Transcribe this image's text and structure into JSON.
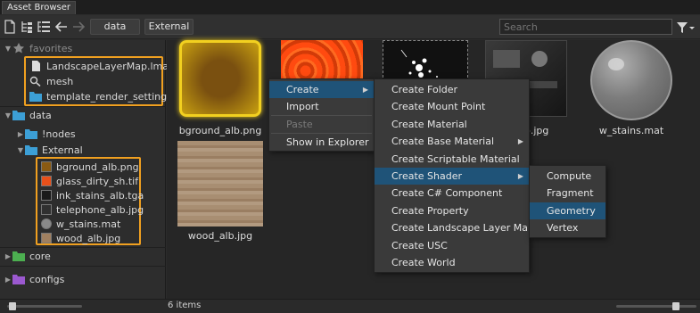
{
  "window": {
    "tab_title": "Asset Browser"
  },
  "toolbar": {
    "path": [
      "data",
      "External"
    ],
    "search_placeholder": "Search",
    "icons": [
      "new-file-icon",
      "tree-view-icon",
      "list-view-icon",
      "back-arrow-icon",
      "forward-arrow-icon",
      "filter-icon"
    ]
  },
  "sidebar": {
    "favorites_label": "favorites",
    "favorites": [
      {
        "label": "LandscapeLayerMap.lmap",
        "icon": "file-icon"
      },
      {
        "label": "mesh",
        "icon": "search-icon"
      },
      {
        "label": "template_render_settings",
        "icon": "folder-icon"
      }
    ],
    "data_label": "data",
    "nodes_label": "!nodes",
    "external_label": "External",
    "external_files": [
      {
        "label": "bground_alb.png",
        "color": "#8a5a12"
      },
      {
        "label": "glass_dirty_sh.tif",
        "color": "#e8501a"
      },
      {
        "label": "ink_stains_alb.tga",
        "color": "#1a1a1a"
      },
      {
        "label": "telephone_alb.jpg",
        "color": "#303030"
      },
      {
        "label": "w_stains.mat",
        "color": "#8a8a8a"
      },
      {
        "label": "wood_alb.jpg",
        "color": "#a08060"
      }
    ],
    "core_label": "core",
    "configs_label": "configs"
  },
  "content": {
    "thumbnails": [
      {
        "label": "bground_alb.png"
      },
      {
        "label": ""
      },
      {
        "label": ""
      },
      {
        "label": "_alb.jpg"
      },
      {
        "label": "w_stains.mat"
      },
      {
        "label": "wood_alb.jpg"
      }
    ]
  },
  "status": {
    "items_count": "6 items"
  },
  "context_menu": {
    "items": [
      "Create",
      "Import",
      "Paste",
      "Show in Explorer"
    ]
  },
  "create_menu": {
    "items": [
      "Create Folder",
      "Create Mount Point",
      "Create Material",
      "Create Base Material",
      "Create Scriptable Material",
      "Create Shader",
      "Create C# Component",
      "Create Property",
      "Create Landscape Layer Map",
      "Create USC",
      "Create World"
    ]
  },
  "shader_menu": {
    "items": [
      "Compute",
      "Fragment",
      "Geometry",
      "Vertex"
    ]
  },
  "colors": {
    "highlight_orange": "#f0a020",
    "menu_selected": "#1f5378",
    "folder_blue": "#3c9fd6",
    "folder_green": "#4caf50",
    "folder_purple": "#9b59d0"
  }
}
